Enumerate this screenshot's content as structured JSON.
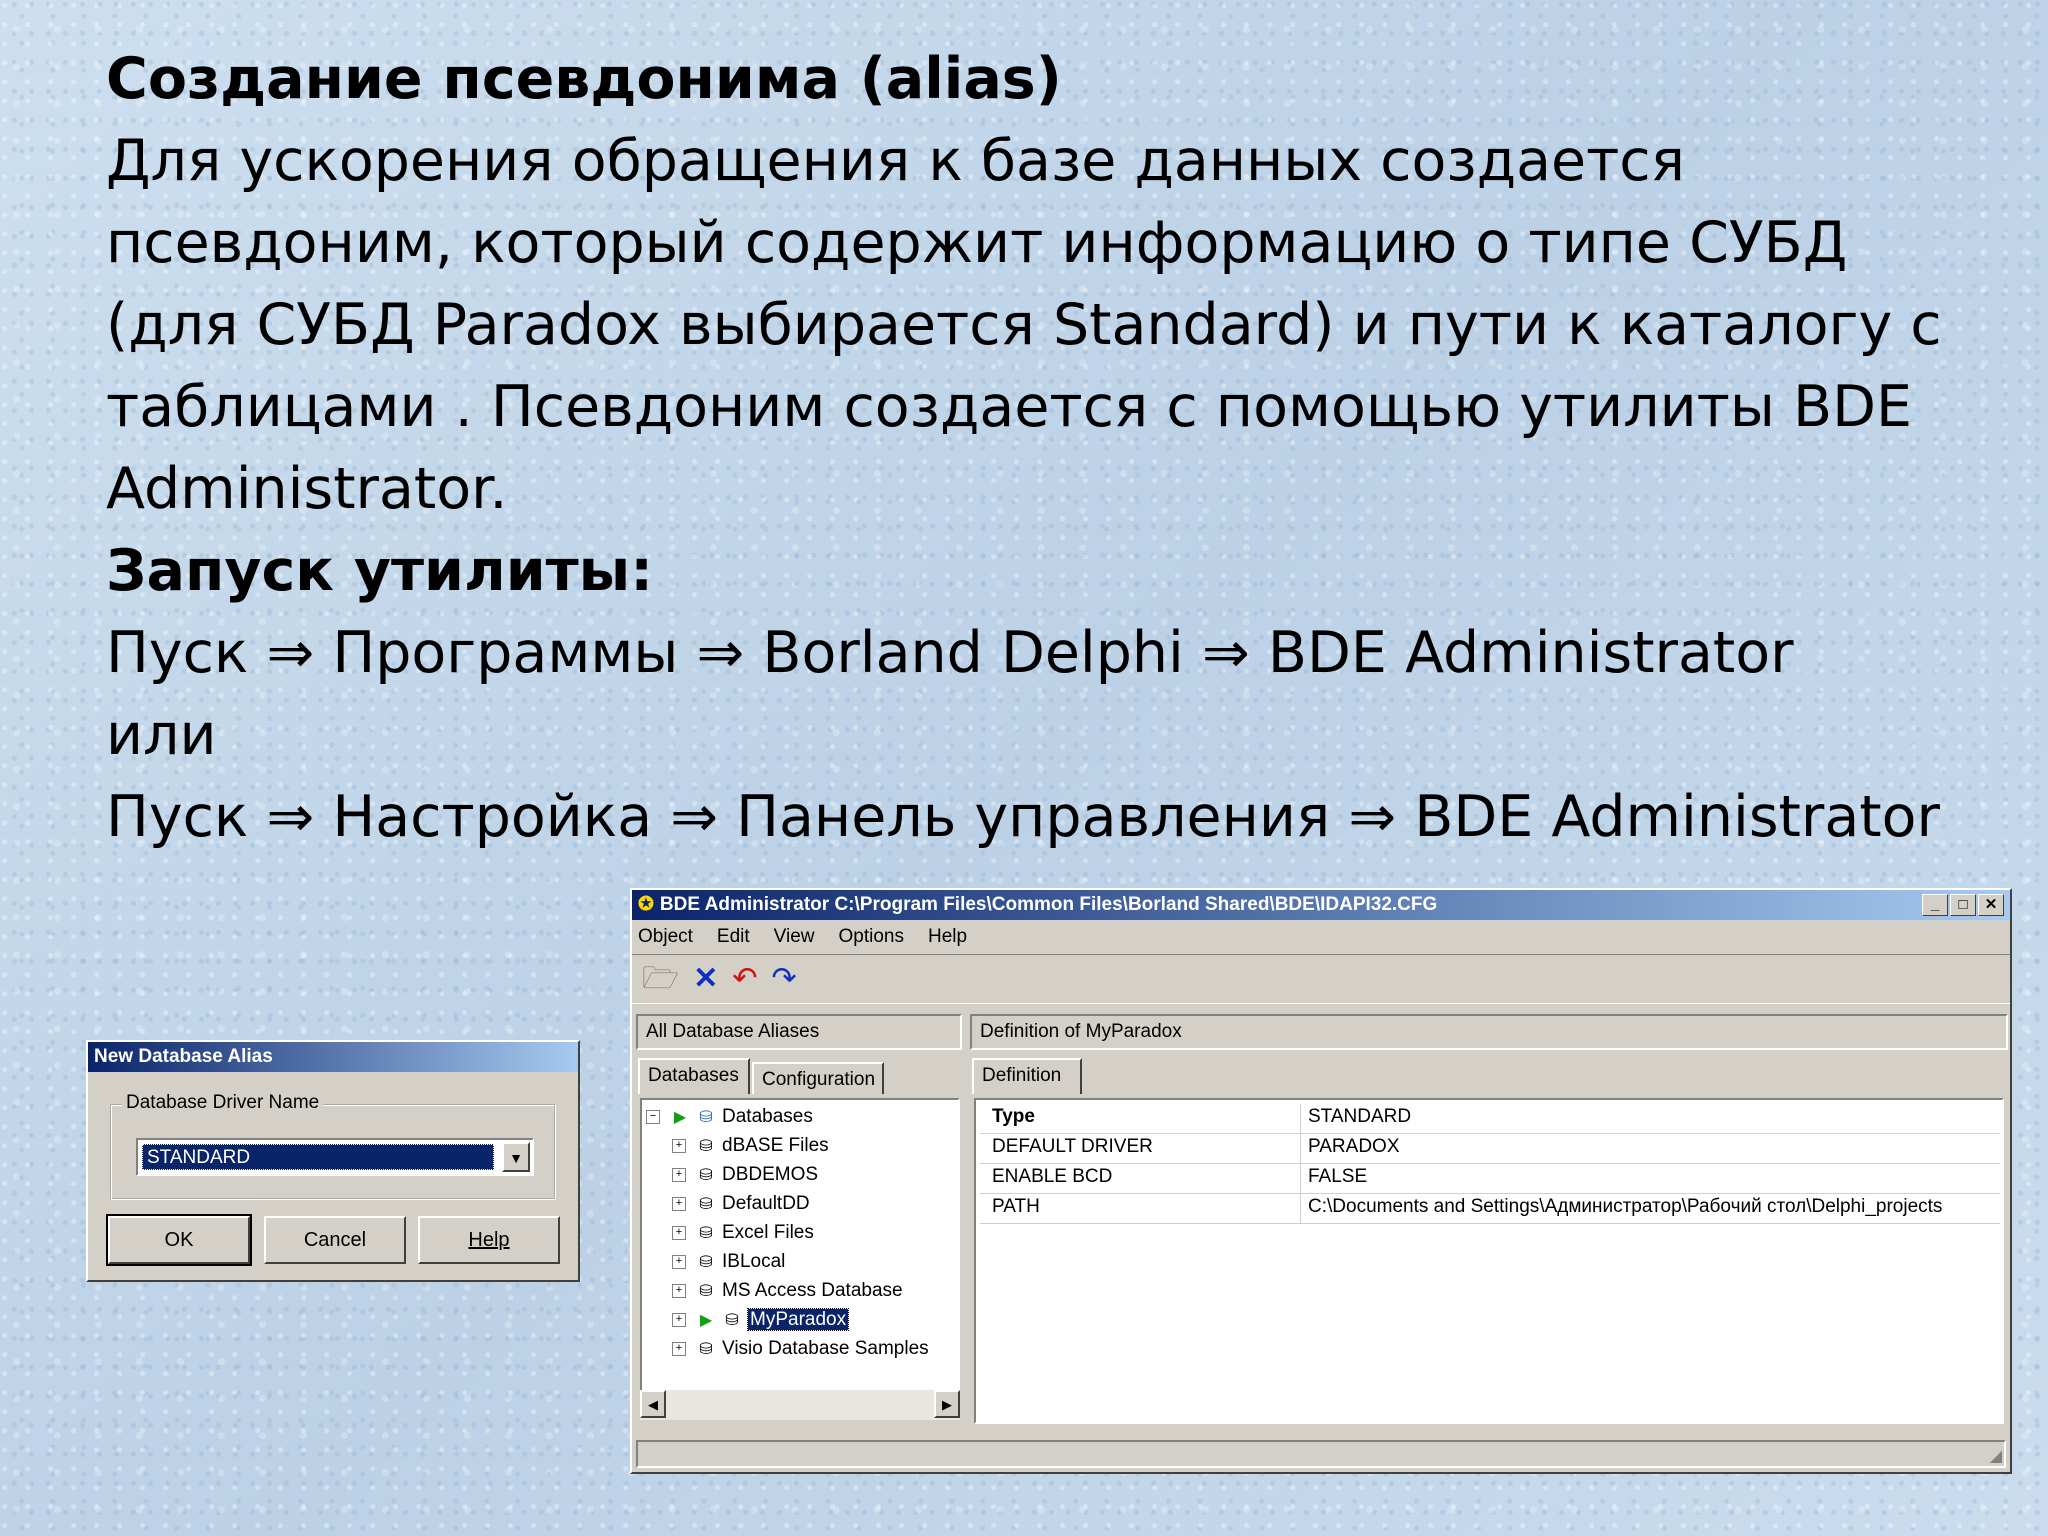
{
  "slide": {
    "heading1": "Создание псевдонима (alias)",
    "paragraph": "Для ускорения обращения к базе данных создается псевдоним, который содержит информацию о типе СУБД (для СУБД Paradox выбирается Standard) и пути к каталогу с таблицами . Псевдоним создается с помощью утилиты BDE Administrator.",
    "heading2": "Запуск утилиты:",
    "path1": "Пуск ⇒ Программы ⇒ Borland Delphi ⇒ BDE Administrator",
    "or": "или",
    "path2": "Пуск ⇒ Настройка ⇒ Панель управления ⇒ BDE Administrator"
  },
  "alias_dialog": {
    "title": "New Database Alias",
    "group_label": "Database Driver Name",
    "driver_value": "STANDARD",
    "ok": "OK",
    "cancel": "Cancel",
    "help": "Help"
  },
  "bde": {
    "title": "BDE Administrator  C:\\Program Files\\Common Files\\Borland Shared\\BDE\\IDAPI32.CFG",
    "menu": [
      "Object",
      "Edit",
      "View",
      "Options",
      "Help"
    ],
    "left_header": "All Database Aliases",
    "right_header": "Definition of MyParadox",
    "tabs_left": [
      "Databases",
      "Configuration"
    ],
    "tab_right": "Definition",
    "tree_root": "Databases",
    "tree_items": [
      "dBASE Files",
      "DBDEMOS",
      "DefaultDD",
      "Excel Files",
      "IBLocal",
      "MS Access Database",
      "MyParadox",
      "Visio Database Samples"
    ],
    "definition": [
      {
        "key": "Type",
        "value": "STANDARD"
      },
      {
        "key": "DEFAULT DRIVER",
        "value": "PARADOX"
      },
      {
        "key": "ENABLE BCD",
        "value": "FALSE"
      },
      {
        "key": "PATH",
        "value": "C:\\Documents and Settings\\Администратор\\Рабочий стол\\Delphi_projects"
      }
    ]
  },
  "colors": {
    "title_active": "#0a246a",
    "window_face": "#d4d0c8",
    "selection": "#0a246a"
  }
}
